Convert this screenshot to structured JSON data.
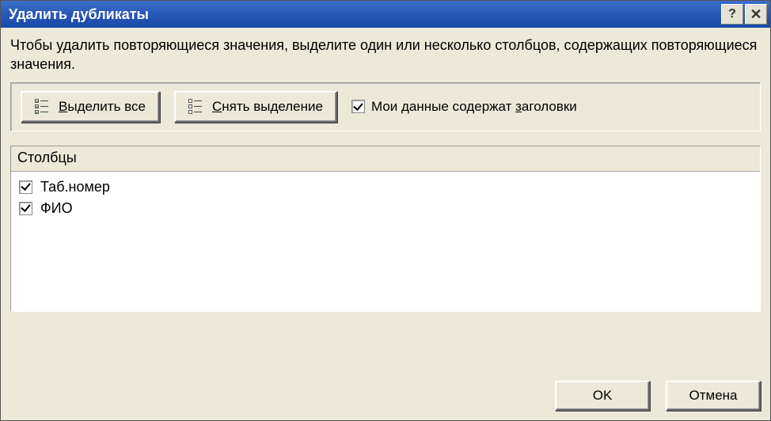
{
  "titlebar": {
    "title": "Удалить дубликаты"
  },
  "instruction": "Чтобы удалить повторяющиеся значения, выделите один или несколько столбцов, содержащих повторяющиеся значения.",
  "toolbar": {
    "select_all_prefix": "В",
    "select_all_rest": "ыделить все",
    "deselect_prefix": "С",
    "deselect_rest": "нять выделение",
    "headers_prefix": "Мои данные содержат ",
    "headers_underlined": "з",
    "headers_rest": "аголовки",
    "headers_checked": true
  },
  "columns": {
    "header": "Столбцы",
    "items": [
      {
        "label": "Таб.номер",
        "checked": true
      },
      {
        "label": "ФИО",
        "checked": true
      }
    ]
  },
  "footer": {
    "ok": "OK",
    "cancel": "Отмена"
  }
}
